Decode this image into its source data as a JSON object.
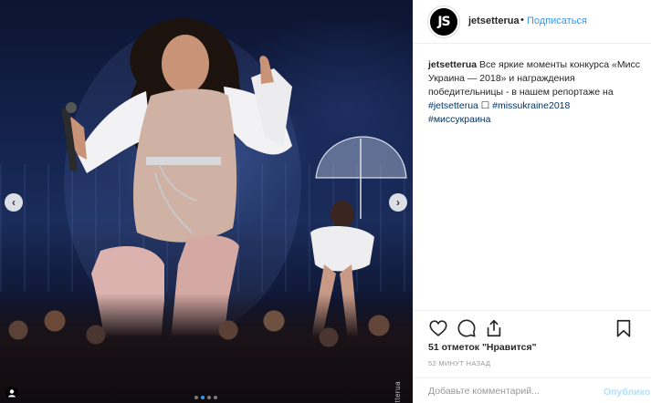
{
  "post": {
    "username": "jetsetterua",
    "avatar_text": "JS",
    "separator": "•",
    "follow_label": "Подписаться",
    "caption_user": "jetsetterua",
    "caption_text": " Все яркие моменты конкурса «Мисс Украина — 2018» и награждения победительницы - в нашем репортаже на ",
    "caption_tag1": "#jetsetterua",
    "caption_glyph": " ☐ ",
    "caption_tag2": "#missukraine2018",
    "caption_tag3": "#миссукраина",
    "likes_text": "51 отметок \"Нравится\"",
    "time_text": "52 минут назад",
    "comment_placeholder": "Добавьте комментарий...",
    "publish_label": "Опубликовать"
  },
  "media": {
    "watermark": "jetsetterua",
    "prev_icon": "‹",
    "next_icon": "›",
    "slide_count": 4,
    "active_slide": 2
  },
  "colors": {
    "link": "#003569",
    "follow": "#3897f0",
    "muted": "#999999"
  },
  "icons": [
    "chevron-left-icon",
    "chevron-right-icon",
    "heart-icon",
    "comment-icon",
    "share-icon",
    "bookmark-icon",
    "user-tag-icon",
    "umbrella-icon"
  ]
}
